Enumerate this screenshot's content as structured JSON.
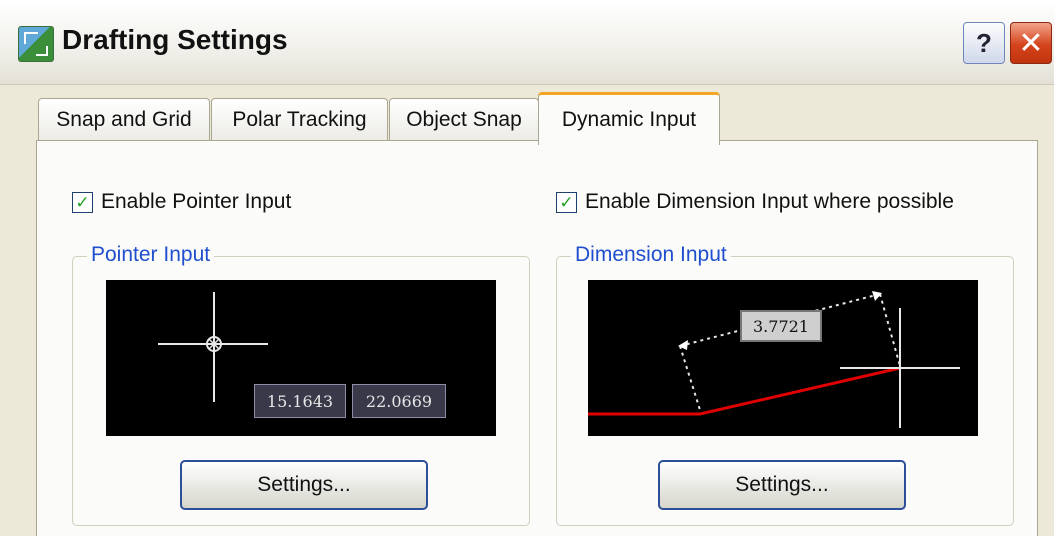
{
  "window": {
    "title": "Drafting Settings",
    "help_glyph": "?",
    "close_glyph": "✕"
  },
  "tabs": [
    {
      "label": "Snap and Grid",
      "active": false
    },
    {
      "label": "Polar Tracking",
      "active": false
    },
    {
      "label": "Object Snap",
      "active": false
    },
    {
      "label": "Dynamic Input",
      "active": true
    }
  ],
  "pointer": {
    "checkbox_label": "Enable Pointer Input",
    "checked": true,
    "group_title": "Pointer Input",
    "preview": {
      "x_value": "15.1643",
      "y_value": "22.0669"
    },
    "settings_label": "Settings..."
  },
  "dimension": {
    "checkbox_label": "Enable Dimension Input where possible",
    "checked": true,
    "group_title": "Dimension Input",
    "preview": {
      "dimension_value": "3.7721"
    },
    "settings_label": "Settings..."
  },
  "colors": {
    "accent_tab": "#f4a524",
    "group_title": "#1f4fcf",
    "preview_background": "#000000",
    "dimension_line": "#e00000",
    "check_mark": "#21a121"
  },
  "icons": {
    "app": "drafting-settings-icon",
    "help": "help-icon",
    "close": "close-icon",
    "check": "checkmark-icon"
  }
}
